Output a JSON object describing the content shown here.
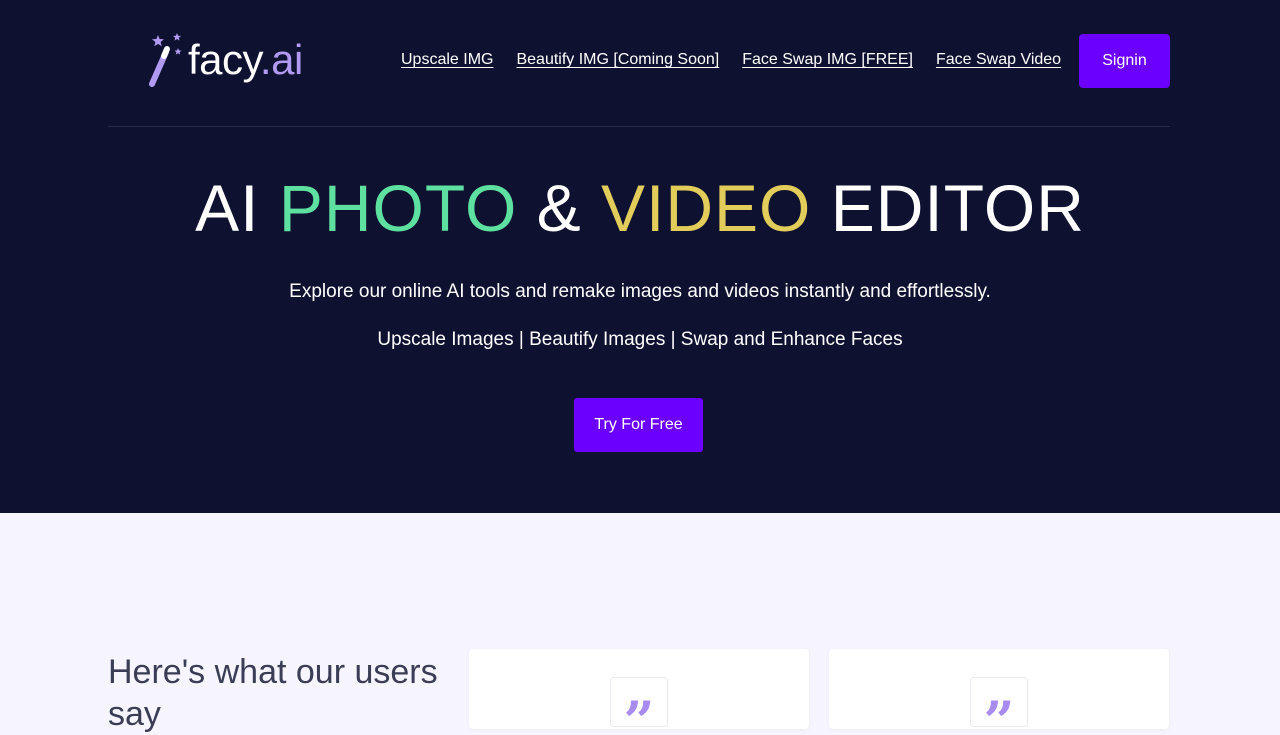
{
  "brand": {
    "name_main": "facy",
    "name_suffix": ".ai",
    "icon": "magic-wand-icon",
    "accent_color": "#b19bf2"
  },
  "nav": {
    "links": [
      {
        "label": "Upscale IMG"
      },
      {
        "label": "Beautify IMG [Coming Soon]"
      },
      {
        "label": "Face Swap IMG [FREE]"
      },
      {
        "label": "Face Swap Video"
      }
    ],
    "signin_label": "Signin"
  },
  "hero": {
    "title_part1": "AI ",
    "title_part2": "PHOTO",
    "title_part3": " & ",
    "title_part4": "VIDEO",
    "title_part5": " EDITOR",
    "subtitle": "Explore our online AI tools and remake images and videos instantly and effortlessly.",
    "features": "Upscale Images | Beautify Images | Swap and Enhance Faces",
    "cta_label": "Try For Free",
    "colors": {
      "background": "#0f1130",
      "photo": "#5ee0a0",
      "video": "#e2cd5a",
      "button": "#6b00ff"
    }
  },
  "testimonials": {
    "heading": "Here's what our users say",
    "quote_icon": "quote-icon",
    "quote_glyph": "”"
  }
}
